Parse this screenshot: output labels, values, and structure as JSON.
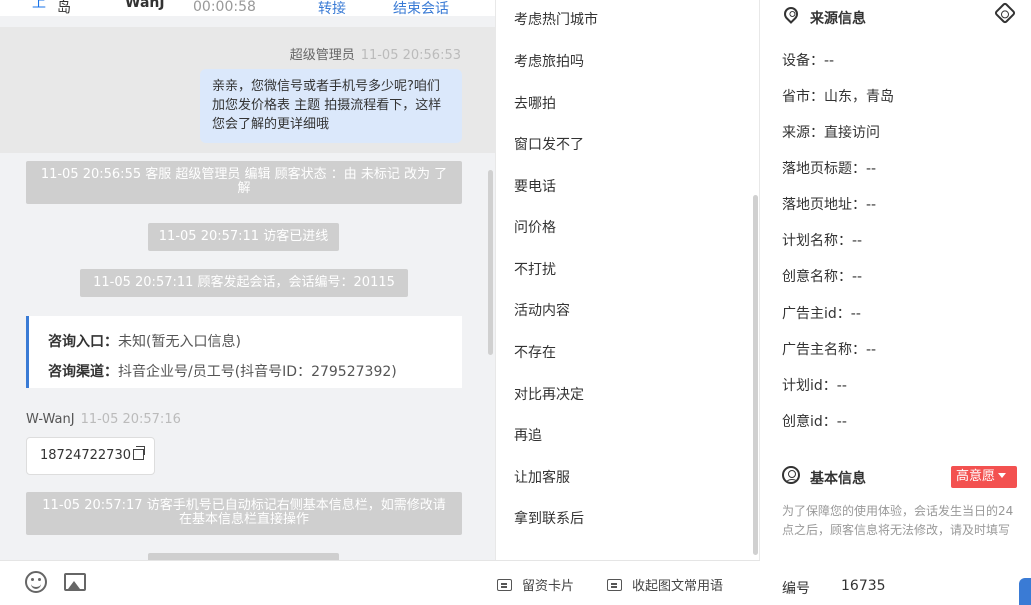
{
  "top_bar": {
    "region_a": "上",
    "region": "岛",
    "visitor_name": "WanJ",
    "duration": "00:00:58",
    "transfer_label": "转接",
    "end_label": "结束会话"
  },
  "chat": {
    "agent_name": "超级管理员",
    "agent_time": "11-05 20:56:53",
    "agent_message": "亲亲，您微信号或者手机号多少呢?咱们加您发价格表 主题 拍摄流程看下，这样您会了解的更详细哦",
    "system_1": "11-05 20:56:55 客服 超级管理员 编辑 顾客状态 ：由 未标记 改为 了解",
    "system_2": "11-05 20:57:11 访客已进线",
    "system_3": "11-05 20:57:11 顾客发起会话，会话编号：20115",
    "entry_label": "咨询入口：",
    "entry_value": "未知(暂无入口信息)",
    "channel_label": "咨询渠道：",
    "channel_value": "抖音企业号/员工号(抖音号ID：279527392)",
    "visitor_sender": "W-WanJ",
    "visitor_time": "11-05 20:57:16",
    "visitor_phone": "18724722730",
    "system_5": "11-05 20:57:17 访客手机号已自动标记右侧基本信息栏，如需修改请在基本信息栏直接操作"
  },
  "toolbar": {
    "emoji_icon": "emoji-icon",
    "image_icon": "image-icon",
    "card_label": "留资卡片",
    "fold_label": "收起图文常用语"
  },
  "quick_replies": [
    "考虑热门城市",
    "考虑旅拍吗",
    "去哪拍",
    "窗口发不了",
    "要电话",
    "问价格",
    "不打扰",
    "活动内容",
    "不存在",
    "对比再决定",
    "再追",
    "让加客服",
    "拿到联系后"
  ],
  "source_info": {
    "title": "来源信息",
    "fields": [
      "设备：--",
      "省市：山东，青岛",
      "来源：直接访问",
      "落地页标题：--",
      "落地页地址：--",
      "计划名称：--",
      "创意名称：--",
      "广告主id：--",
      "广告主名称：--",
      "计划id：--",
      "创意id：--"
    ]
  },
  "basic_info": {
    "title": "基本信息",
    "badge": "高意愿",
    "badge_color": "#f35150",
    "note": "为了保障您的使用体验，会话发生当日的24点之后，顾客信息将无法修改，请及时填写",
    "number_label": "编号",
    "number_value": "16735"
  },
  "colors": {
    "accent": "#3a7bd5",
    "agent_bubble": "#dbe8fb",
    "system_bubble": "#cfcfcf"
  }
}
